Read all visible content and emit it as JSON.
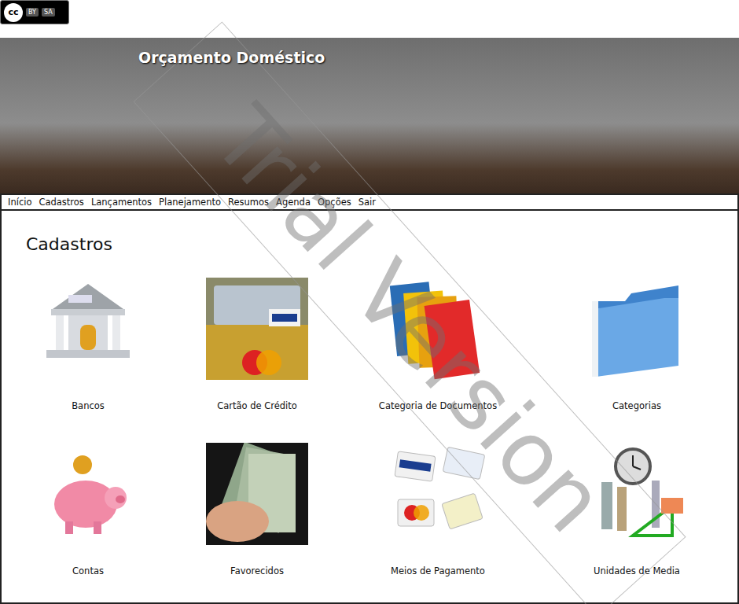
{
  "license": {
    "symbol": "cc",
    "badges": [
      "BY",
      "SA"
    ]
  },
  "banner": {
    "title": "Orçamento Doméstico"
  },
  "nav": {
    "items": [
      "Início",
      "Cadastros",
      "Lançamentos",
      "Planejamento",
      "Resumos",
      "Agenda",
      "Opções",
      "Sair"
    ]
  },
  "page": {
    "title": "Cadastros"
  },
  "tiles": [
    {
      "label": "Bancos",
      "kind": "bank"
    },
    {
      "label": "Cartão de Crédito",
      "kind": "cards"
    },
    {
      "label": "Categoria de Documentos",
      "kind": "folders"
    },
    {
      "label": "Categorias",
      "kind": "folder"
    },
    {
      "label": "Contas",
      "kind": "piggy"
    },
    {
      "label": "Favorecidos",
      "kind": "money"
    },
    {
      "label": "Meios de Pagamento",
      "kind": "payment"
    },
    {
      "label": "Unidades de Media",
      "kind": "tools"
    }
  ],
  "watermark": "Trial Version"
}
